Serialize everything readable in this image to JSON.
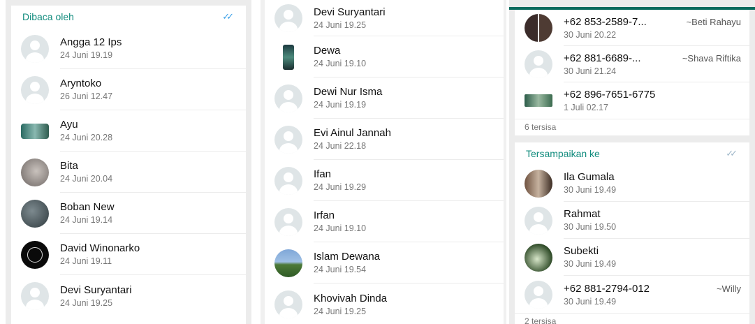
{
  "panel1": {
    "section_title": "Dibaca oleh",
    "ticks_icon": "double-check-blue",
    "contacts": [
      {
        "name": "Angga 12 Ips",
        "time": "24 Juni 19.19"
      },
      {
        "name": "Aryntoko",
        "time": "26 Juni 12.47"
      },
      {
        "name": "Ayu",
        "time": "24 Juni 20.28"
      },
      {
        "name": "Bita",
        "time": "24 Juni 20.04"
      },
      {
        "name": "Boban New",
        "time": "24 Juni 19.14"
      },
      {
        "name": "David Winonarko",
        "time": "24 Juni 19.11"
      },
      {
        "name": "Devi Suryantari",
        "time": "24 Juni 19.25"
      }
    ]
  },
  "panel2": {
    "contacts": [
      {
        "name": "Devi Suryantari",
        "time": "24 Juni 19.25"
      },
      {
        "name": "Dewa",
        "time": "24 Juni 19.10"
      },
      {
        "name": "Dewi Nur Isma",
        "time": "24 Juni 19.19"
      },
      {
        "name": "Evi Ainul Jannah",
        "time": "24 Juni 22.18"
      },
      {
        "name": "Ifan",
        "time": "24 Juni 19.29"
      },
      {
        "name": "Irfan",
        "time": "24 Juni 19.10"
      },
      {
        "name": "Islam Dewana",
        "time": "24 Juni 19.54"
      },
      {
        "name": "Khovivah Dinda",
        "time": "24 Juni 19.25"
      }
    ]
  },
  "panel3": {
    "read_contacts": [
      {
        "name": "+62 853-2589-7...",
        "alias": "~Beti Rahayu",
        "time": "30 Juni 20.22"
      },
      {
        "name": "+62 881-6689-...",
        "alias": "~Shava Riftika",
        "time": "30 Juni 21.24"
      },
      {
        "name": "+62 896-7651-6775",
        "alias": "",
        "time": "1 Juli 02.17"
      }
    ],
    "read_remaining": "6 tersisa",
    "delivered_title": "Tersampaikan ke",
    "delivered_ticks_icon": "double-check-gray",
    "delivered_contacts": [
      {
        "name": "Ila Gumala",
        "alias": "",
        "time": "30 Juni 19.49"
      },
      {
        "name": "Rahmat",
        "alias": "",
        "time": "30 Juni 19.50"
      },
      {
        "name": "Subekti",
        "alias": "",
        "time": "30 Juni 19.49"
      },
      {
        "name": "+62 881-2794-012",
        "alias": "~Willy",
        "time": "30 Juni 19.49"
      }
    ],
    "delivered_remaining": "2 tersisa"
  },
  "colors": {
    "accent": "#128c7e",
    "read_ticks": "#3aa0e8",
    "delivered_ticks": "#9fb7c9",
    "status_bar": "#0a6b5e"
  }
}
